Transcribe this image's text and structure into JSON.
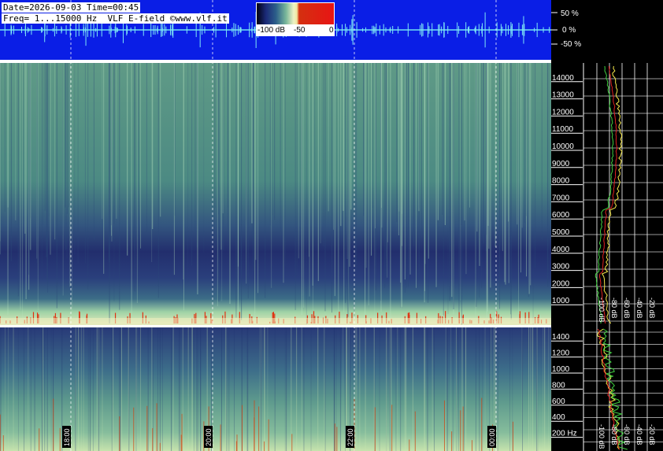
{
  "header": {
    "line1": "Date=2026-09-03 Time=00:45",
    "line2": "Freq= 1...15000 Hz  VLF E-field ©www.vlf.it"
  },
  "colorbar": {
    "labels": [
      "-100 dB",
      "-50",
      "0"
    ]
  },
  "chart_data": [
    {
      "type": "line",
      "title": "",
      "ylabel": "",
      "y_ticks": [
        "50 %",
        "0 %",
        "-50 %"
      ],
      "ylim": [
        -100,
        100
      ],
      "description_series": [
        {
          "values": [
            0
          ]
        }
      ]
    },
    {
      "type": "heatmap",
      "x_ticks": [
        "18:00",
        "20:00",
        "22:00",
        "00:00"
      ],
      "y_ticks": [
        "1000",
        "2000",
        "3000",
        "4000",
        "5000",
        "6000",
        "7000",
        "8000",
        "9000",
        "10000",
        "11000",
        "12000",
        "13000",
        "14000"
      ],
      "ylim": [
        0,
        15000
      ],
      "colorscale_db": [
        -100,
        0
      ]
    },
    {
      "type": "heatmap",
      "x_ticks": [
        "18:00",
        "20:00",
        "22:00",
        "00:00"
      ],
      "y_ticks": [
        "200 Hz",
        "400",
        "600",
        "800",
        "1000",
        "1200",
        "1400"
      ],
      "ylim": [
        0,
        1500
      ],
      "colorscale_db": [
        -100,
        0
      ]
    },
    {
      "type": "line",
      "x_ticks": [
        "-100 dB",
        "-80 dB",
        "-60 dB",
        "-40 dB",
        "-20 dB"
      ],
      "xlim": [
        -100,
        0
      ]
    }
  ]
}
